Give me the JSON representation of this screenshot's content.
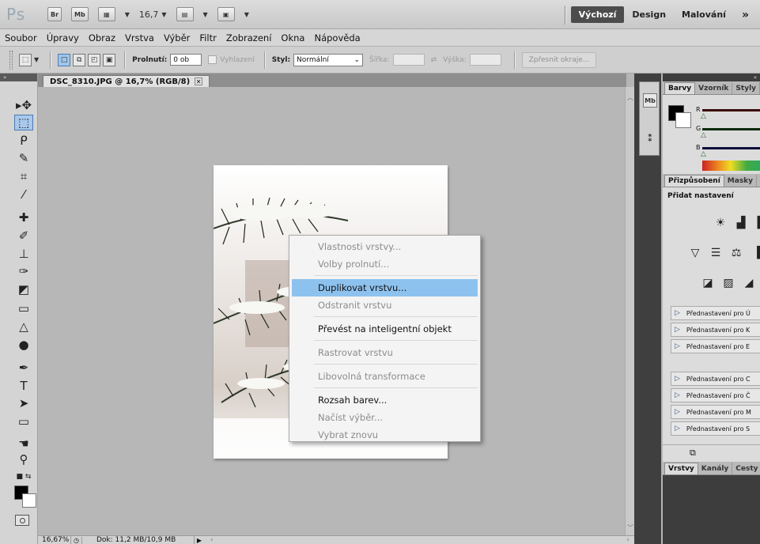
{
  "app": {
    "logo": "Ps",
    "bridge": "Br",
    "minibridge": "Mb",
    "zoom": "16,7",
    "workspaces": {
      "active": "Výchozí",
      "items": [
        "Design",
        "Malování"
      ],
      "more": "»"
    }
  },
  "menu": [
    "Soubor",
    "Úpravy",
    "Obraz",
    "Vrstva",
    "Výběr",
    "Filtr",
    "Zobrazení",
    "Okna",
    "Nápověda"
  ],
  "options": {
    "feather_label": "Prolnutí:",
    "feather_value": "0 ob",
    "antialias_label": "Vyhlazení",
    "style_label": "Styl:",
    "style_value": "Normální",
    "width_label": "Šířka:",
    "height_label": "Výška:",
    "refine_button": "Zpřesnit okraje..."
  },
  "document": {
    "tab_title": "DSC_8310.JPG @ 16,7% (RGB/8)",
    "status_zoom": "16,67%",
    "status_doc": "Dok: 11,2 MB/10,9 MB"
  },
  "context_menu": [
    {
      "label": "Vlastnosti vrstvy...",
      "state": "disabled"
    },
    {
      "label": "Volby prolnutí...",
      "state": "disabled"
    },
    {
      "label": "Duplikovat vrstvu...",
      "state": "highlighted"
    },
    {
      "label": "Odstranit vrstvu",
      "state": "disabled"
    },
    {
      "label": "Převést na inteligentní objekt",
      "state": "enabled"
    },
    {
      "label": "Rastrovat vrstvu",
      "state": "disabled"
    },
    {
      "label": "Libovolná transformace",
      "state": "disabled"
    },
    {
      "label": "Rozsah barev...",
      "state": "enabled"
    },
    {
      "label": "Načíst výběr...",
      "state": "disabled"
    },
    {
      "label": "Vybrat znovu",
      "state": "disabled"
    }
  ],
  "panels": {
    "color_tabs": [
      "Barvy",
      "Vzorník",
      "Styly"
    ],
    "adjust_tabs": [
      "Přizpůsobení",
      "Masky"
    ],
    "adjust_title": "Přidat nastavení",
    "presets": [
      "Přednastavení pro Ú",
      "Přednastavení pro K",
      "Přednastavení pro E",
      "Přednastavení pro C",
      "Přednastavení pro Č",
      "Přednastavení pro M",
      "Přednastavení pro S"
    ],
    "layer_tabs": [
      "Vrstvy",
      "Kanály",
      "Cesty"
    ],
    "channels": [
      "R",
      "G",
      "B"
    ]
  },
  "colors": {
    "highlight": "#8ec2ee",
    "workspace_active": "#4c4c4c",
    "tool_selected": "#a8c8ec"
  }
}
